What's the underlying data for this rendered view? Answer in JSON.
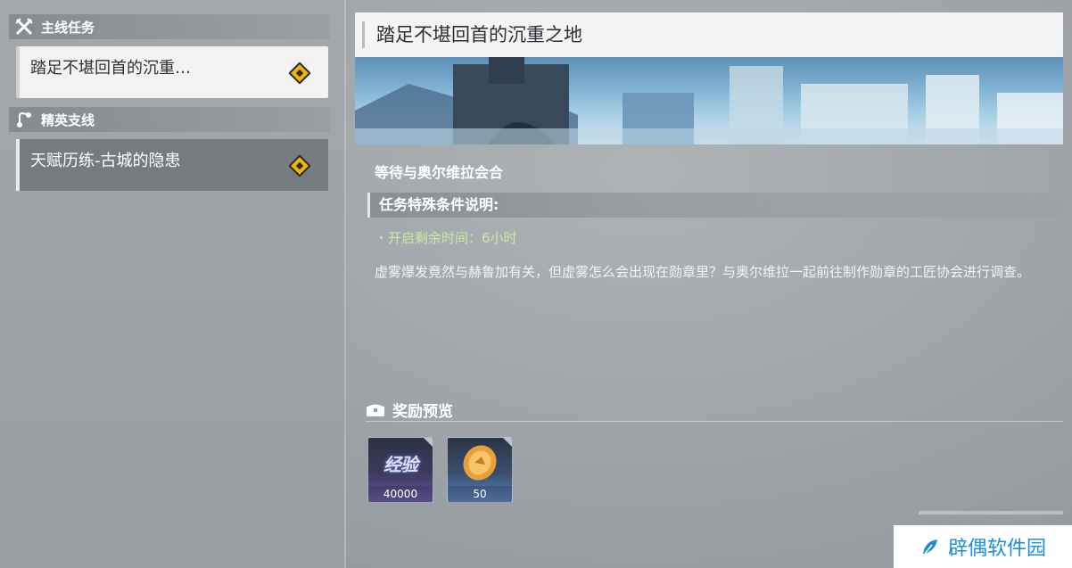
{
  "sidebar": {
    "main_header": "主线任务",
    "main_quest": "踏足不堪回首的沉重…",
    "elite_header": "精英支线",
    "elite_quest": "天赋历练-古城的隐患"
  },
  "detail": {
    "title": "踏足不堪回首的沉重之地",
    "subtitle": "等待与奥尔维拉会合",
    "condition_header": "任务特殊条件说明:",
    "condition_item": "・开启剩余时间：6小时",
    "description": "虚雾爆发竟然与赫鲁加有关，但虚雾怎么会出现在勋章里？与奥尔维拉一起前往制作勋章的工匠协会进行调查。"
  },
  "rewards": {
    "header": "奖励预览",
    "items": [
      {
        "label": "经验",
        "count": "40000"
      },
      {
        "label": "",
        "count": "50"
      }
    ]
  },
  "watermark": "辟偶软件园",
  "colors": {
    "accent": "#f1b400",
    "highlight_text": "#cde9a4"
  }
}
